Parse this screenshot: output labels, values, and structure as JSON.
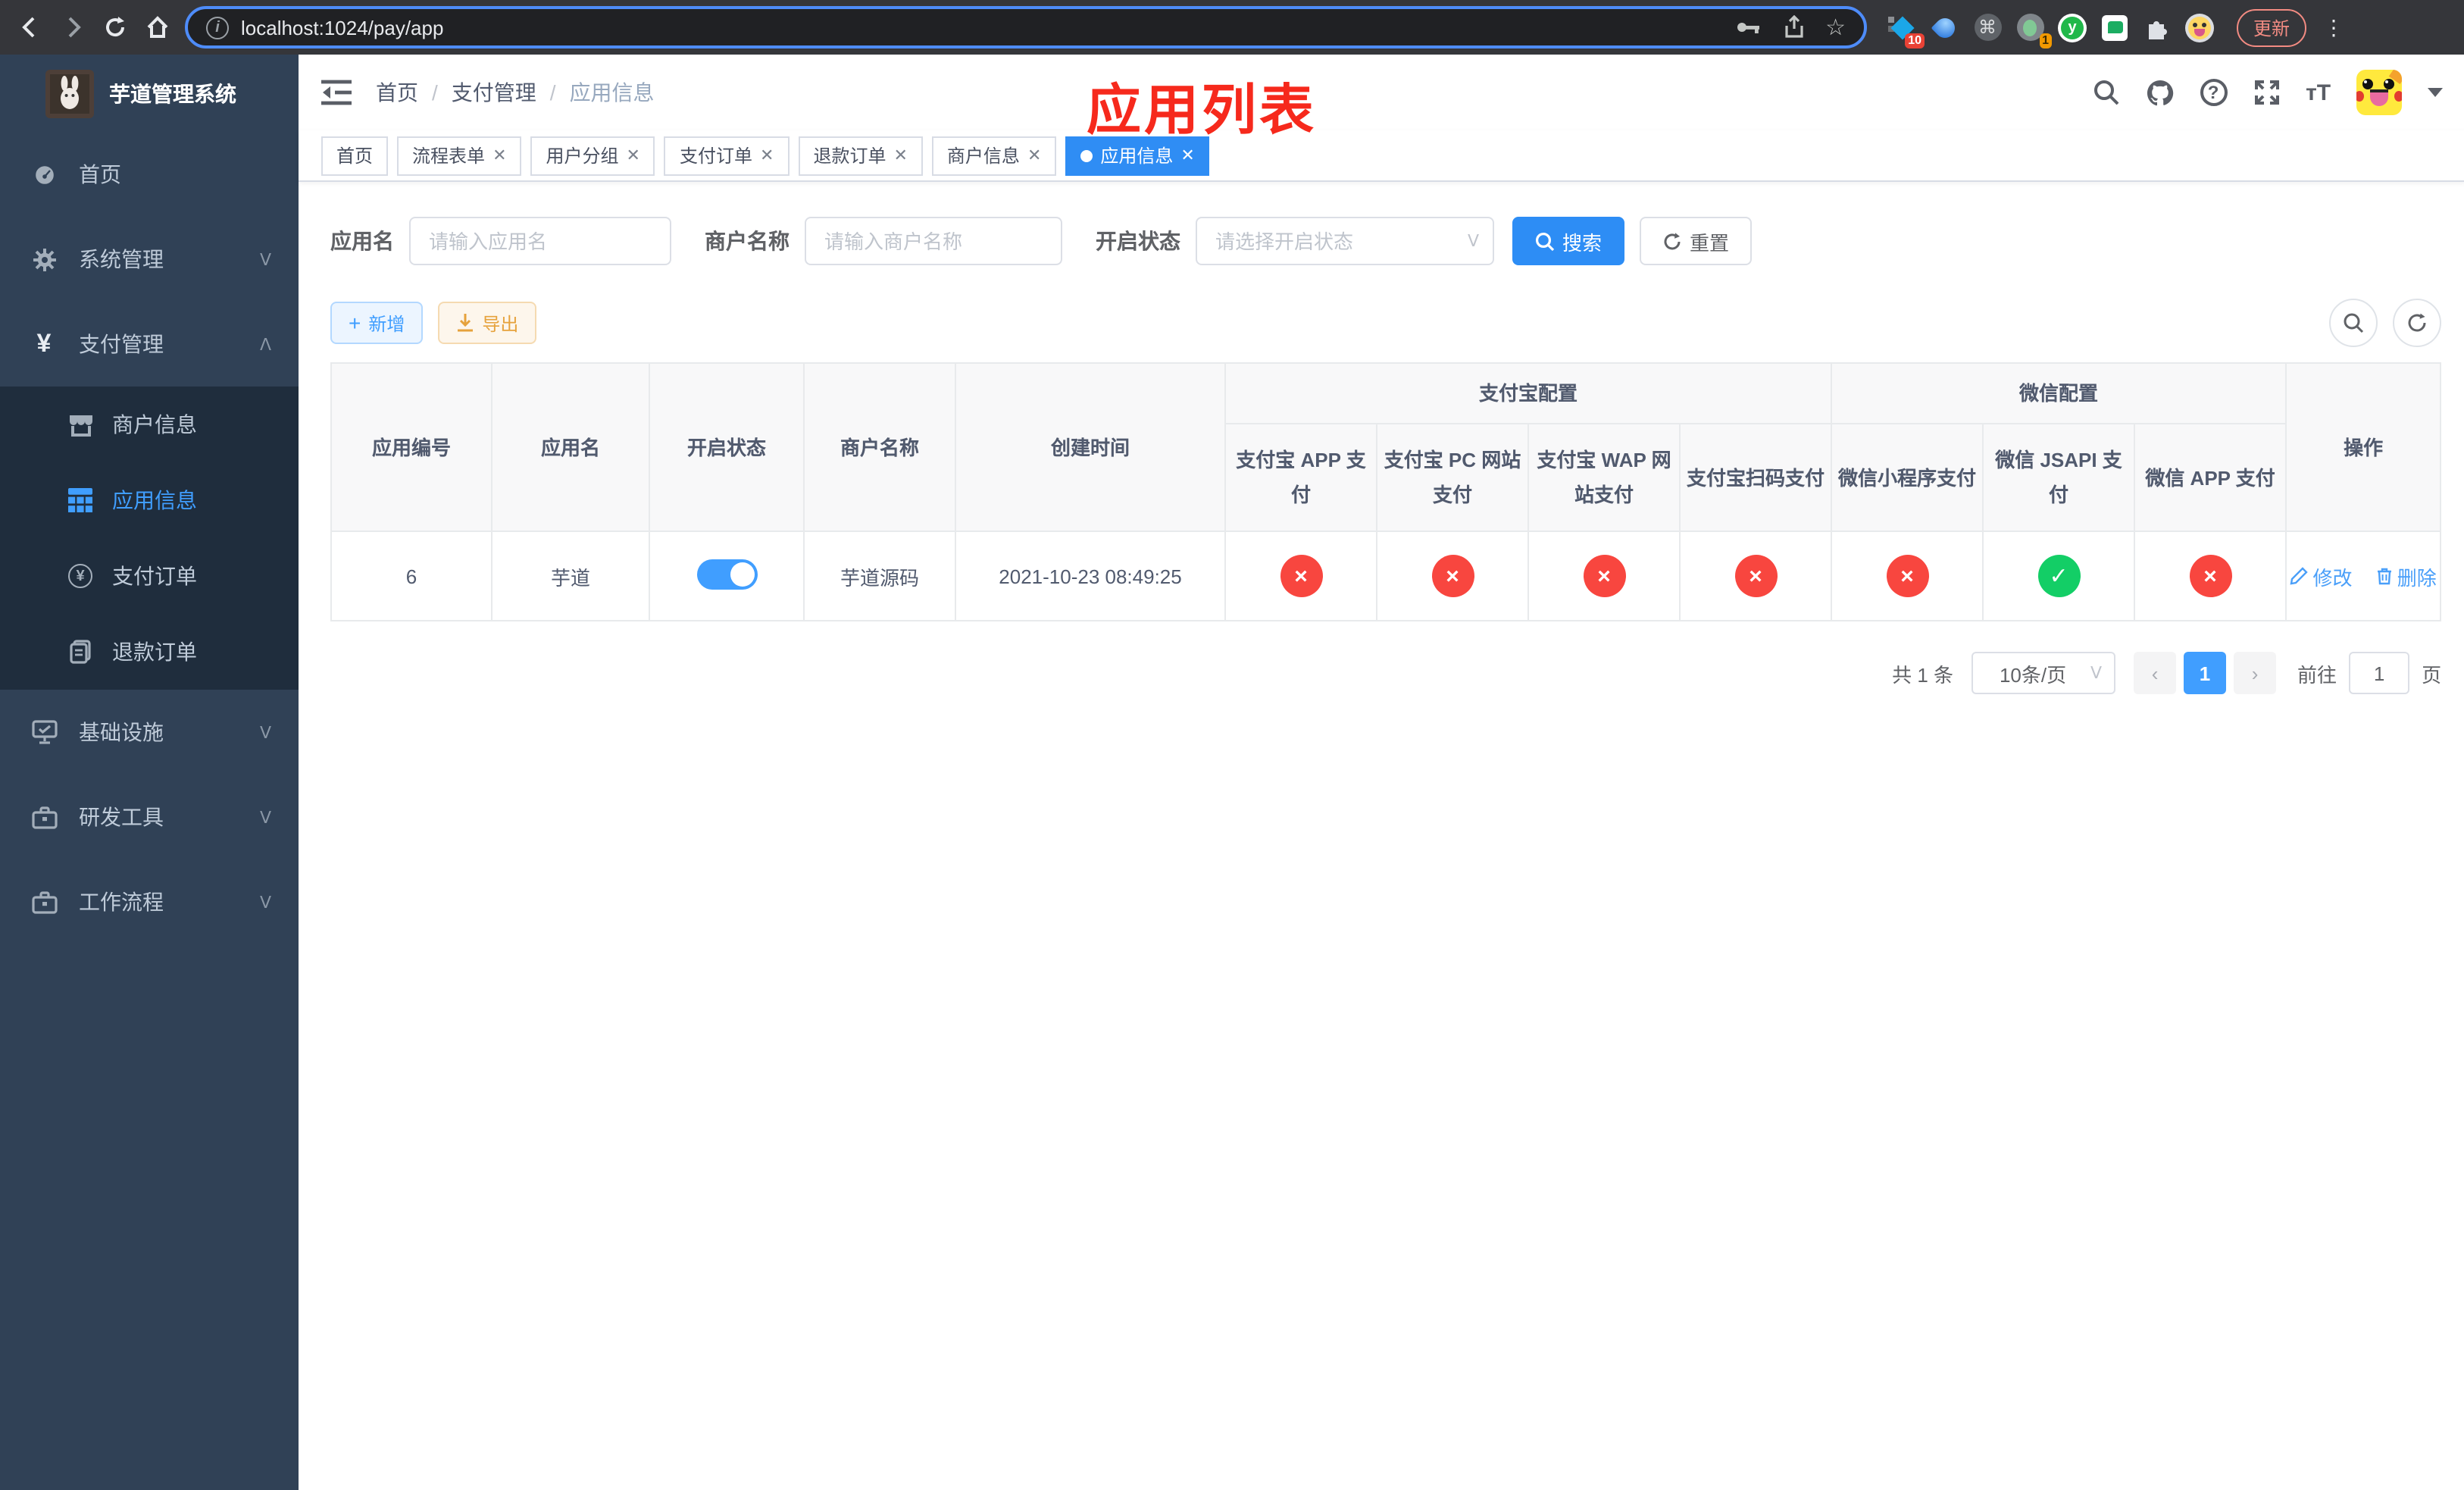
{
  "browser": {
    "url": "localhost:1024/pay/app",
    "update_label": "更新",
    "ext_badge_10": "10",
    "ext_badge_1": "1",
    "ycirc_letter": "y",
    "cmd_glyph": "⌘",
    "star_glyph": "☆",
    "dots_glyph": "⋮",
    "info_glyph": "i"
  },
  "sidebar": {
    "title": "芋道管理系统",
    "items": [
      {
        "label": "首页"
      },
      {
        "label": "系统管理"
      },
      {
        "label": "支付管理"
      },
      {
        "label": "基础设施"
      },
      {
        "label": "研发工具"
      },
      {
        "label": "工作流程"
      }
    ],
    "sub": [
      {
        "label": "商户信息"
      },
      {
        "label": "应用信息"
      },
      {
        "label": "支付订单"
      },
      {
        "label": "退款订单"
      }
    ]
  },
  "navbar": {
    "breadcrumb": [
      "首页",
      "支付管理",
      "应用信息"
    ],
    "annotation": "应用列表"
  },
  "tabs": [
    {
      "label": "首页"
    },
    {
      "label": "流程表单"
    },
    {
      "label": "用户分组"
    },
    {
      "label": "支付订单"
    },
    {
      "label": "退款订单"
    },
    {
      "label": "商户信息"
    },
    {
      "label": "应用信息"
    }
  ],
  "filters": {
    "app_name_label": "应用名",
    "app_name_placeholder": "请输入应用名",
    "merchant_label": "商户名称",
    "merchant_placeholder": "请输入商户名称",
    "status_label": "开启状态",
    "status_placeholder": "请选择开启状态",
    "search_label": "搜索",
    "reset_label": "重置"
  },
  "toolbar": {
    "add_label": "新增",
    "export_label": "导出"
  },
  "table": {
    "cols": [
      "应用编号",
      "应用名",
      "开启状态",
      "商户名称",
      "创建时间"
    ],
    "groups": [
      {
        "label": "支付宝配置",
        "children": [
          "支付宝 APP 支付",
          "支付宝 PC 网站支付",
          "支付宝 WAP 网站支付",
          "支付宝扫码支付"
        ]
      },
      {
        "label": "微信配置",
        "children": [
          "微信小程序支付",
          "微信 JSAPI 支付",
          "微信 APP 支付"
        ]
      }
    ],
    "action_col": "操作",
    "row": {
      "id": "6",
      "name": "芋道",
      "merchant": "芋道源码",
      "created": "2021-10-23 08:49:25",
      "statuses": [
        {
          "cls": "circle red",
          "glyph": "×"
        },
        {
          "cls": "circle red",
          "glyph": "×"
        },
        {
          "cls": "circle red",
          "glyph": "×"
        },
        {
          "cls": "circle red",
          "glyph": "×"
        },
        {
          "cls": "circle red",
          "glyph": "×"
        },
        {
          "cls": "circle green",
          "glyph": "✓"
        },
        {
          "cls": "circle red",
          "glyph": "×"
        }
      ],
      "edit_label": "修改",
      "delete_label": "删除"
    }
  },
  "pagination": {
    "total": "共 1 条",
    "page_size": "10条/页",
    "prev": "‹",
    "page": "1",
    "next": "›",
    "goto_label": "前往",
    "goto_value": "1",
    "page_suffix": "页"
  }
}
